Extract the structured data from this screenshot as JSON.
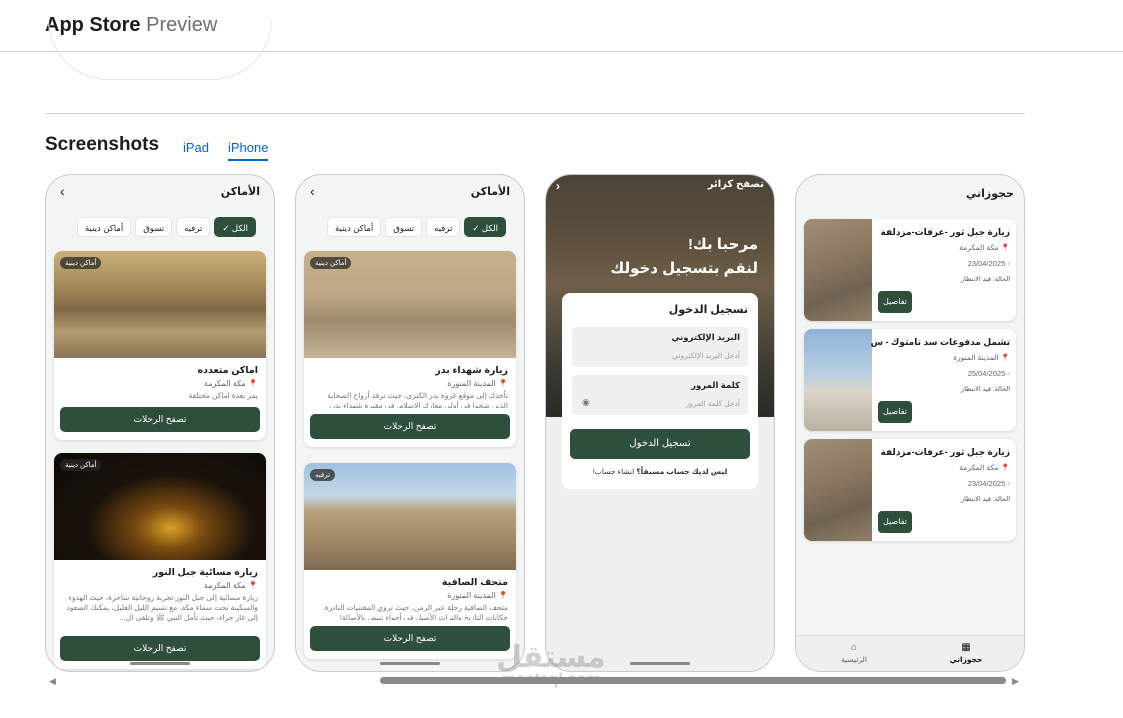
{
  "brand": {
    "name": "App Store",
    "suffix": "Preview"
  },
  "screenshots": {
    "title": "Screenshots",
    "tabs": [
      {
        "label": "iPad",
        "active": false
      },
      {
        "label": "iPhone",
        "active": true
      }
    ]
  },
  "phone1": {
    "header_title": "الأماكن",
    "chips": [
      "الكل",
      "ترفيه",
      "تسوق",
      "أماكن دينية"
    ],
    "cards": [
      {
        "badge": "أماكن دينية",
        "title": "اماكن متعدده",
        "location": "مكة المكرمة",
        "desc": "يمر بعدة اماكن مختلفة",
        "button": "تصفح الرحلات"
      },
      {
        "badge": "أماكن دينية",
        "title": "زيارة مسائية جبل النور",
        "location": "مكة المكرمة",
        "desc": "زيارة مسائية إلى جبل النور تجربة روحانية ساحرة، حيث الهدوء والسكينة تحت سماء مكة. مع نسيم الليل العليل، يمكنك الصعود إلى غار حراء، حيث تأمل النبي ﷺ وتلقى ال...",
        "button": "تصفح الرحلات"
      }
    ]
  },
  "phone2": {
    "header_title": "الأماكن",
    "chips": [
      "الكل",
      "ترفيه",
      "تسوق",
      "أماكن دينية"
    ],
    "cards": [
      {
        "badge": "أماكن دينية",
        "title": "زيارة شهداء بدر",
        "location": "المدينة المنورة",
        "desc": "تأخذك إلى موقع غزوة بدر الكبرى، حيث ترقد أرواح الصحابة الذين ضحوا في أولى معارك الإسلام. في مقبرة شهداء بدر،",
        "button": "تصفح الرحلات"
      },
      {
        "badge": "ترفيه",
        "title": "متحف الصافية",
        "location": "المدينة المنورة",
        "desc": "متحف الصافية رحلة عبر الزمن، حيث تروي المقتنيات النادرة حكايات التاريخ والتراث الأصيل في أجواء تنبض بالأصالة!",
        "button": "تصفح الرحلات"
      }
    ]
  },
  "phone3": {
    "browse_as_visitor": "تصفح كزائر",
    "welcome_line1": "مرحبا بك!",
    "welcome_line2": "لنقم بتسجيل دخولك",
    "form_title": "تسجيل الدخول",
    "email_label": "البريد الإلكتروني",
    "email_placeholder": "أدخل البريد الإلكتروني",
    "password_label": "كلمة المرور",
    "password_placeholder": "أدخل كلمة المرور",
    "login_button": "تسجيل الدخول",
    "no_account": "ليس لديك حساب مسبقاً؟",
    "create_account": "انشاء حساب!"
  },
  "phone4": {
    "title": "حجوزاتي",
    "bookings": [
      {
        "title": "زيارة جبل ثور -عرفات-مزدلفة",
        "location": "مكة المكرمة",
        "date": "23/04/2025",
        "status": "الحالة: قيد الانتظار",
        "button": "تفاصيل"
      },
      {
        "title": "تشمل مدفوعات سد تامتوك - س...",
        "location": "المدينة المنورة",
        "date": "25/04/2025",
        "status": "الحالة: قيد الانتظار",
        "button": "تفاصيل"
      },
      {
        "title": "زيارة جبل ثور -عرفات-مزدلفة",
        "location": "مكة المكرمة",
        "date": "23/04/2025",
        "status": "الحالة: قيد الانتظار",
        "button": "تفاصيل"
      }
    ],
    "nav": [
      {
        "label": "حجوزاتي",
        "icon": "calendar-icon",
        "active": true
      },
      {
        "label": "الرئيسية",
        "icon": "home-icon",
        "active": false
      }
    ]
  },
  "watermark": {
    "arabic": "مستقل",
    "latin": "mostaql.com"
  },
  "colors": {
    "primary_green": "#2e4f3c",
    "link_blue": "#0066cc"
  }
}
